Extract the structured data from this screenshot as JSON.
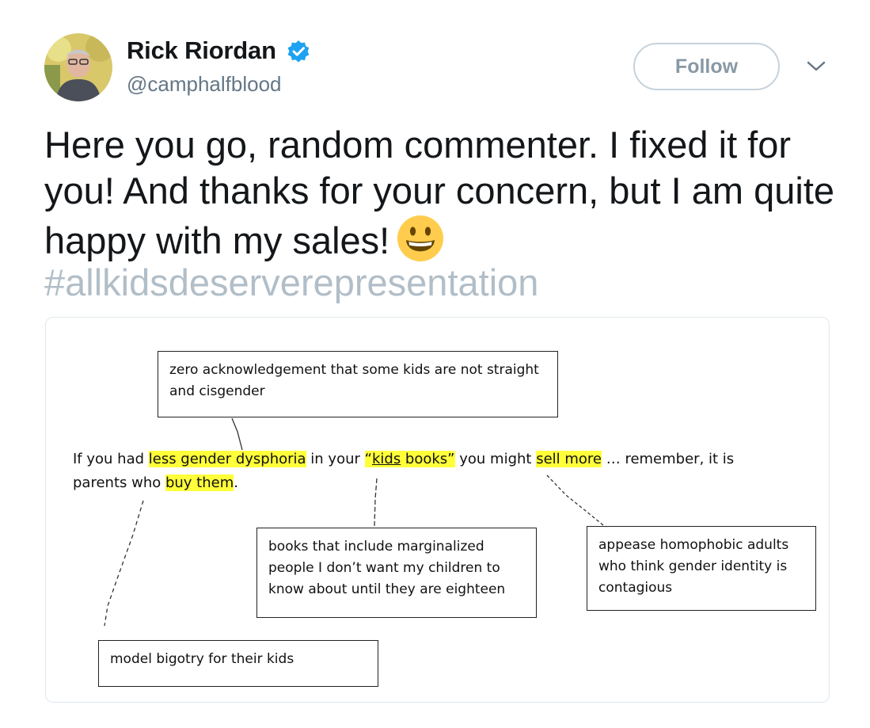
{
  "tweet": {
    "author_name": "Rick Riordan",
    "author_handle": "@camphalfblood",
    "follow_label": "Follow",
    "text": "Here you go, random commenter. I fixed it for you! And thanks for your concern, but I am quite happy with my sales!",
    "hashtag": "#allkidsdeserverepresentation",
    "icons": {
      "avatar": "profile-photo",
      "verified": "verified-badge-icon",
      "more": "chevron-down-icon",
      "emoji": "grinning-face-emoji"
    },
    "colors": {
      "verified": "#1da1f2",
      "hashtag": "#b1bec8",
      "follow_border": "#c7d2db",
      "highlight": "#ffff3a"
    }
  },
  "image": {
    "comment": {
      "seg1": "If you had ",
      "hl1": "less gender dysphoria",
      "seg2": " in your ",
      "q_open": "“",
      "kids": "kids",
      "books": " books”",
      "seg3": " you might ",
      "hl3": "sell more",
      "seg4": " … remember, it is parents who ",
      "hl4": "buy them",
      "seg5": "."
    },
    "notes": {
      "top": "zero acknowledgement that some kids are not straight and cisgender",
      "middle": "books that include marginalized people I don’t want my children to know about until they are eighteen",
      "right": "appease homophobic adults who think gender identity is contagious",
      "bottom": "model bigotry for their kids"
    }
  }
}
